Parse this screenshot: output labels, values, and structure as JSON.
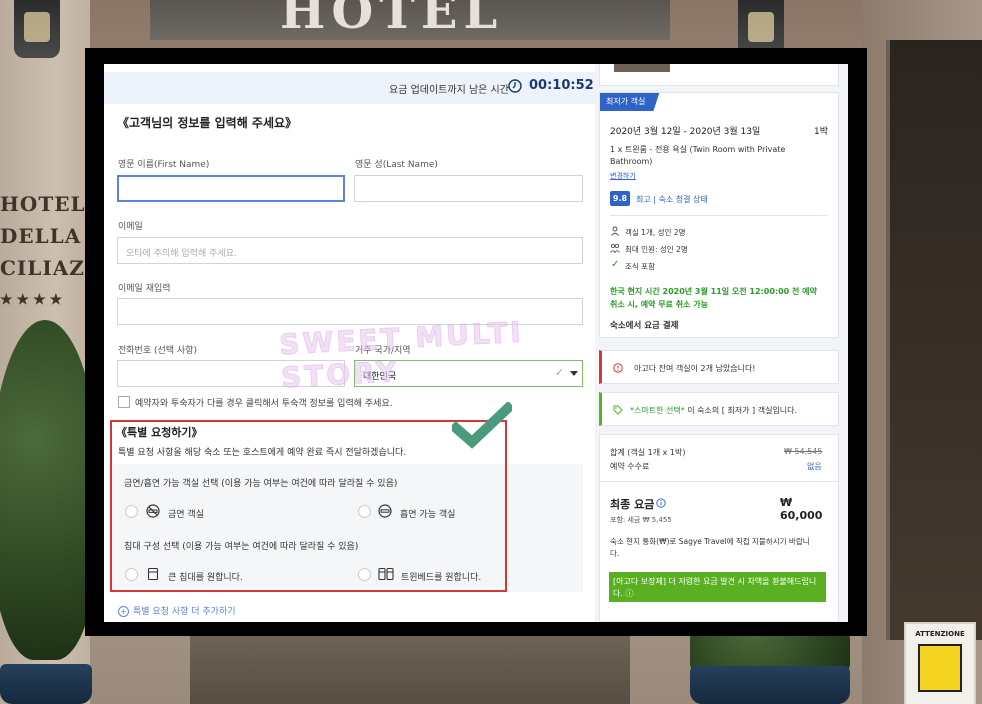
{
  "background": {
    "awning_text": "HOTEL",
    "sign_lines": [
      "HOTEL",
      "DELLA",
      "CILIAZI"
    ],
    "sign_stars": "★★★★",
    "poster_text": "ATTENZIONE"
  },
  "watermark": "SWEET MULTI STORY",
  "timer": {
    "label": "요금 업데이트까지 남은 시간",
    "value": "00:10:52"
  },
  "form": {
    "section_title": "《고객님의 정보를 입력해 주세요》",
    "first_name_label": "영문 이름(First Name)",
    "last_name_label": "영문 성(Last Name)",
    "email_label": "이메일",
    "email_placeholder": "오타에 주의해 입력해 주세요.",
    "email_confirm_label": "이메일 재입력",
    "phone_label": "전화번호 (선택 사항)",
    "country_label": "거주 국가/지역",
    "country_value": "대한민국",
    "guest_checkbox_label": "예약자와 투숙자가 다를 경우 클릭해서 투숙객 정보를 입력해 주세요."
  },
  "special": {
    "title": "《특별 요청하기》",
    "description": "특별 요청 사항을 해당 숙소 또는 호스트에게 예약 완료 즉시 전달하겠습니다.",
    "smoking_heading": "금연/흡연 가능 객실 선택 (이용 가능 여부는 여건에 따라 달라질 수 있음)",
    "smoking_options": [
      "금연 객실",
      "흡연 가능 객실"
    ],
    "bed_heading": "침대 구성 선택 (이용 가능 여부는 여건에 따라 달라질 수 있음)",
    "bed_options": [
      "큰 침대를 원합니다.",
      "트윈베드를 원합니다."
    ],
    "add_more": "특별 요청 사항 더 추가하기"
  },
  "summary": {
    "ribbon": "최저가 객실",
    "dates": "2020년 3월 12일 - 2020년 3월 13일",
    "nights": "1박",
    "room_line1": "1 x 트윈룸 - 전용 욕실 (Twin Room with Private",
    "room_line2": "Bathroom)",
    "change_link": "변경하기",
    "score": "9.8",
    "score_text": "최고 | 숙소 청결 상태",
    "occupancy": "객실 1개, 성인 2명",
    "max_guests": "최대 인원: 성인 2명",
    "breakfast": "조식 포함",
    "cancel_line1": "한국 현지 시간 2020년 3월 11일 오전 12:00:00 전 예약",
    "cancel_line2": "취소 시, 예약 무료 취소 가능",
    "pay_at_property": "숙소에서 요금 결제",
    "rooms_left": "아고다 잔여 객실이 2개 남았습니다!",
    "smart_choice_highlight": "*스마트한 선택*",
    "smart_choice_rest": " 이 숙소의 [ 최저가 ] 객실입니다.",
    "total_label": "합계 (객실 1개 x 1박)",
    "total_value": "₩ 54,545",
    "fee_label": "예약 수수료",
    "fee_value": "없음",
    "final_label": "최종 요금",
    "final_value": "₩ 60,000",
    "tax_note": "포함: 세금 ₩ 5,455",
    "currency_note_line1": "숙소 현지 통화(₩)로 Sagye Travel에 직접 지불하시기 바랍니",
    "currency_note_line2": "다.",
    "guarantee_line1": "[아고다 보장제] 더 저렴한 요금 발견 시 차액을 환불해드립니",
    "guarantee_line2": "다. ⓘ"
  },
  "colors": {
    "accent_blue": "#2e64c8",
    "highlight_red": "#d33838",
    "success_green": "#5ab022",
    "check_teal": "#4a9a7c"
  }
}
